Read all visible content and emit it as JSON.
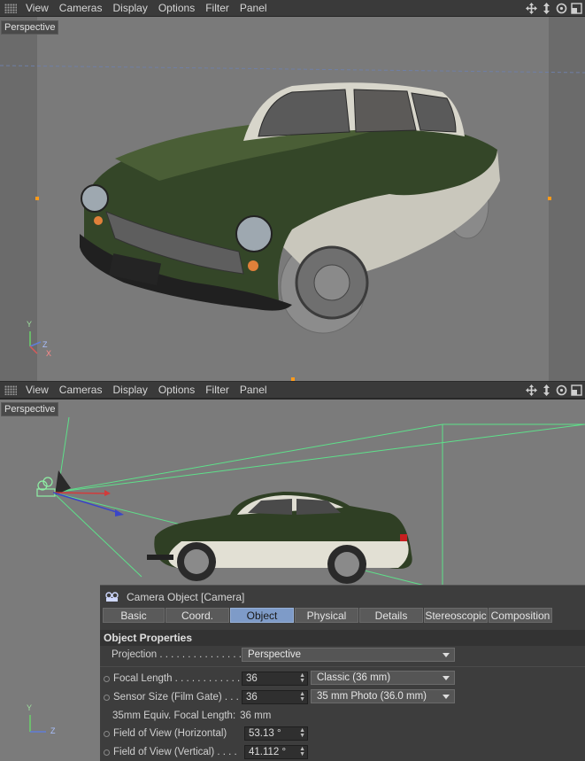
{
  "top_menu": {
    "items": [
      "View",
      "Cameras",
      "Display",
      "Options",
      "Filter",
      "Panel"
    ]
  },
  "top_viewport": {
    "label": "Perspective"
  },
  "bottom_menu": {
    "items": [
      "View",
      "Cameras",
      "Display",
      "Options",
      "Filter",
      "Panel"
    ]
  },
  "bottom_viewport": {
    "label": "Perspective"
  },
  "axis": {
    "y": "Y",
    "z": "Z",
    "x": "X"
  },
  "nav_icons": [
    "move-view-icon",
    "zoom-view-icon",
    "rotate-view-icon",
    "layout-toggle-icon"
  ],
  "attributes": {
    "title": "Camera Object [Camera]",
    "tabs": [
      "Basic",
      "Coord.",
      "Object",
      "Physical",
      "Details",
      "Stereoscopic",
      "Composition"
    ],
    "active_tab": "Object",
    "section": "Object Properties",
    "projection_label": "Projection . . . . . . . . . . . . . . . .",
    "projection_value": "Perspective",
    "focal_length_label": "Focal Length . . . . . . . . . . . .",
    "focal_length_value": "36",
    "focal_length_preset": "Classic (36 mm)",
    "sensor_label": "Sensor Size (Film Gate) . . .",
    "sensor_value": "36",
    "sensor_preset": "35 mm Photo (36.0 mm)",
    "equiv_label": "35mm Equiv. Focal Length:",
    "equiv_value": "36 mm",
    "fov_h_label": "Field of View (Horizontal)",
    "fov_h_value": "53.13 °",
    "fov_v_label": "Field of View (Vertical) . . . .",
    "fov_v_value": "41.112 °"
  },
  "colors": {
    "viewport_bg": "#7a7a7a",
    "car_body": "#2f3f24",
    "car_two_tone": "#d4d2c6",
    "frustum": "#5ee08a",
    "active_tab": "#7e9bc8"
  }
}
